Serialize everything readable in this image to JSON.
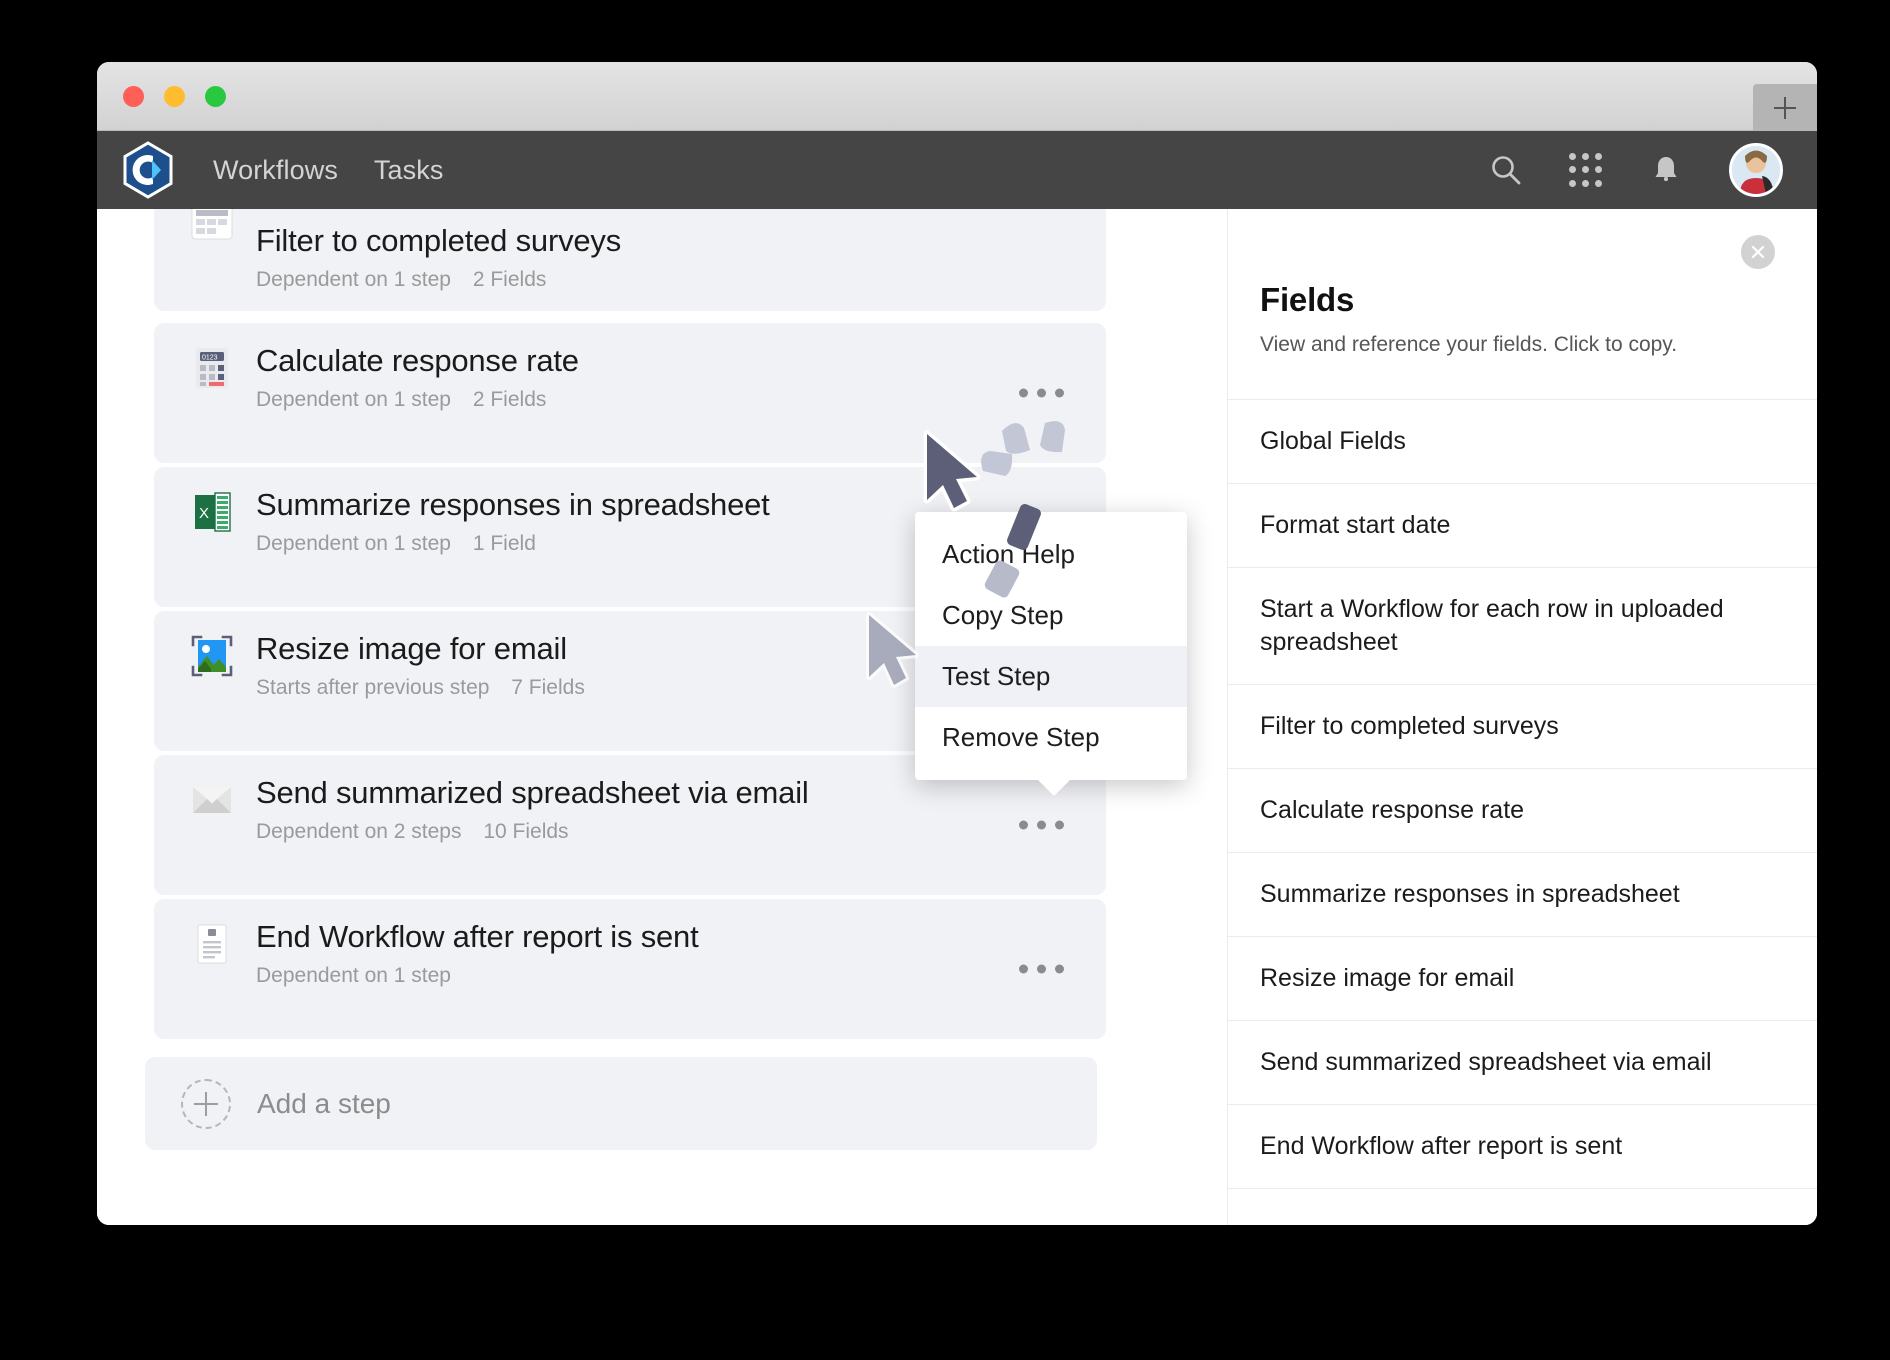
{
  "window": {
    "traffic_lights": [
      "close",
      "minimize",
      "maximize"
    ],
    "new_tab_label": "+"
  },
  "header": {
    "logo_name": "convergence-hexagon-logo",
    "nav": [
      {
        "label": "Workflows",
        "active": true
      },
      {
        "label": "Tasks",
        "active": false
      }
    ],
    "actions": [
      {
        "name": "search-icon"
      },
      {
        "name": "apps-grid-icon"
      },
      {
        "name": "notifications-bell-icon"
      },
      {
        "name": "avatar"
      }
    ],
    "background_color": "#454545"
  },
  "steps": [
    {
      "title": "Filter to completed surveys",
      "meta_dependency": "Dependent on 1 step",
      "meta_fields": "2 Fields",
      "icon": "filter-table-icon",
      "clipped_top": true
    },
    {
      "title": "Calculate response rate",
      "meta_dependency": "Dependent on 1 step",
      "meta_fields": "2 Fields",
      "icon": "calculator-icon"
    },
    {
      "title": "Summarize responses in spreadsheet",
      "meta_dependency": "Dependent on 1 step",
      "meta_fields": "1 Field",
      "icon": "excel-spreadsheet-icon"
    },
    {
      "title": "Resize image for email",
      "meta_dependency": "Starts after previous step",
      "meta_fields": "7 Fields",
      "icon": "resize-image-icon"
    },
    {
      "title": "Send summarized spreadsheet via email",
      "meta_dependency": "Dependent on 2 steps",
      "meta_fields": "10 Fields",
      "icon": "email-envelope-icon"
    },
    {
      "title": "End Workflow after report is sent",
      "meta_dependency": "Dependent on 1 step",
      "meta_fields": "",
      "icon": "document-report-icon"
    }
  ],
  "add_step": {
    "label": "Add a step",
    "icon": "plus-circle-dashed-icon"
  },
  "context_menu": {
    "items": [
      {
        "label": "Action Help",
        "active": false
      },
      {
        "label": "Copy Step",
        "active": false
      },
      {
        "label": "Test Step",
        "active": true
      },
      {
        "label": "Remove Step",
        "active": false
      }
    ]
  },
  "fields_panel": {
    "title": "Fields",
    "subtitle": "View and reference your fields. Click to copy.",
    "close_icon": "close-icon",
    "items": [
      "Global Fields",
      "Format start date",
      "Start a Workflow for each row in uploaded spreadsheet",
      "Filter to completed surveys",
      "Calculate response rate",
      "Summarize responses in spreadsheet",
      "Resize image for email",
      "Send summarized spreadsheet via email",
      "End Workflow after report is sent"
    ]
  },
  "cursor": {
    "state": "click",
    "name": "mouse-pointer"
  },
  "colors": {
    "header_bg": "#454545",
    "card_bg": "#f1f2f6",
    "accent_blue": "#1d4f8c",
    "accent_light_blue": "#4fc3f7",
    "excel_green": "#1d7044",
    "cursor": "#5c5f77"
  }
}
